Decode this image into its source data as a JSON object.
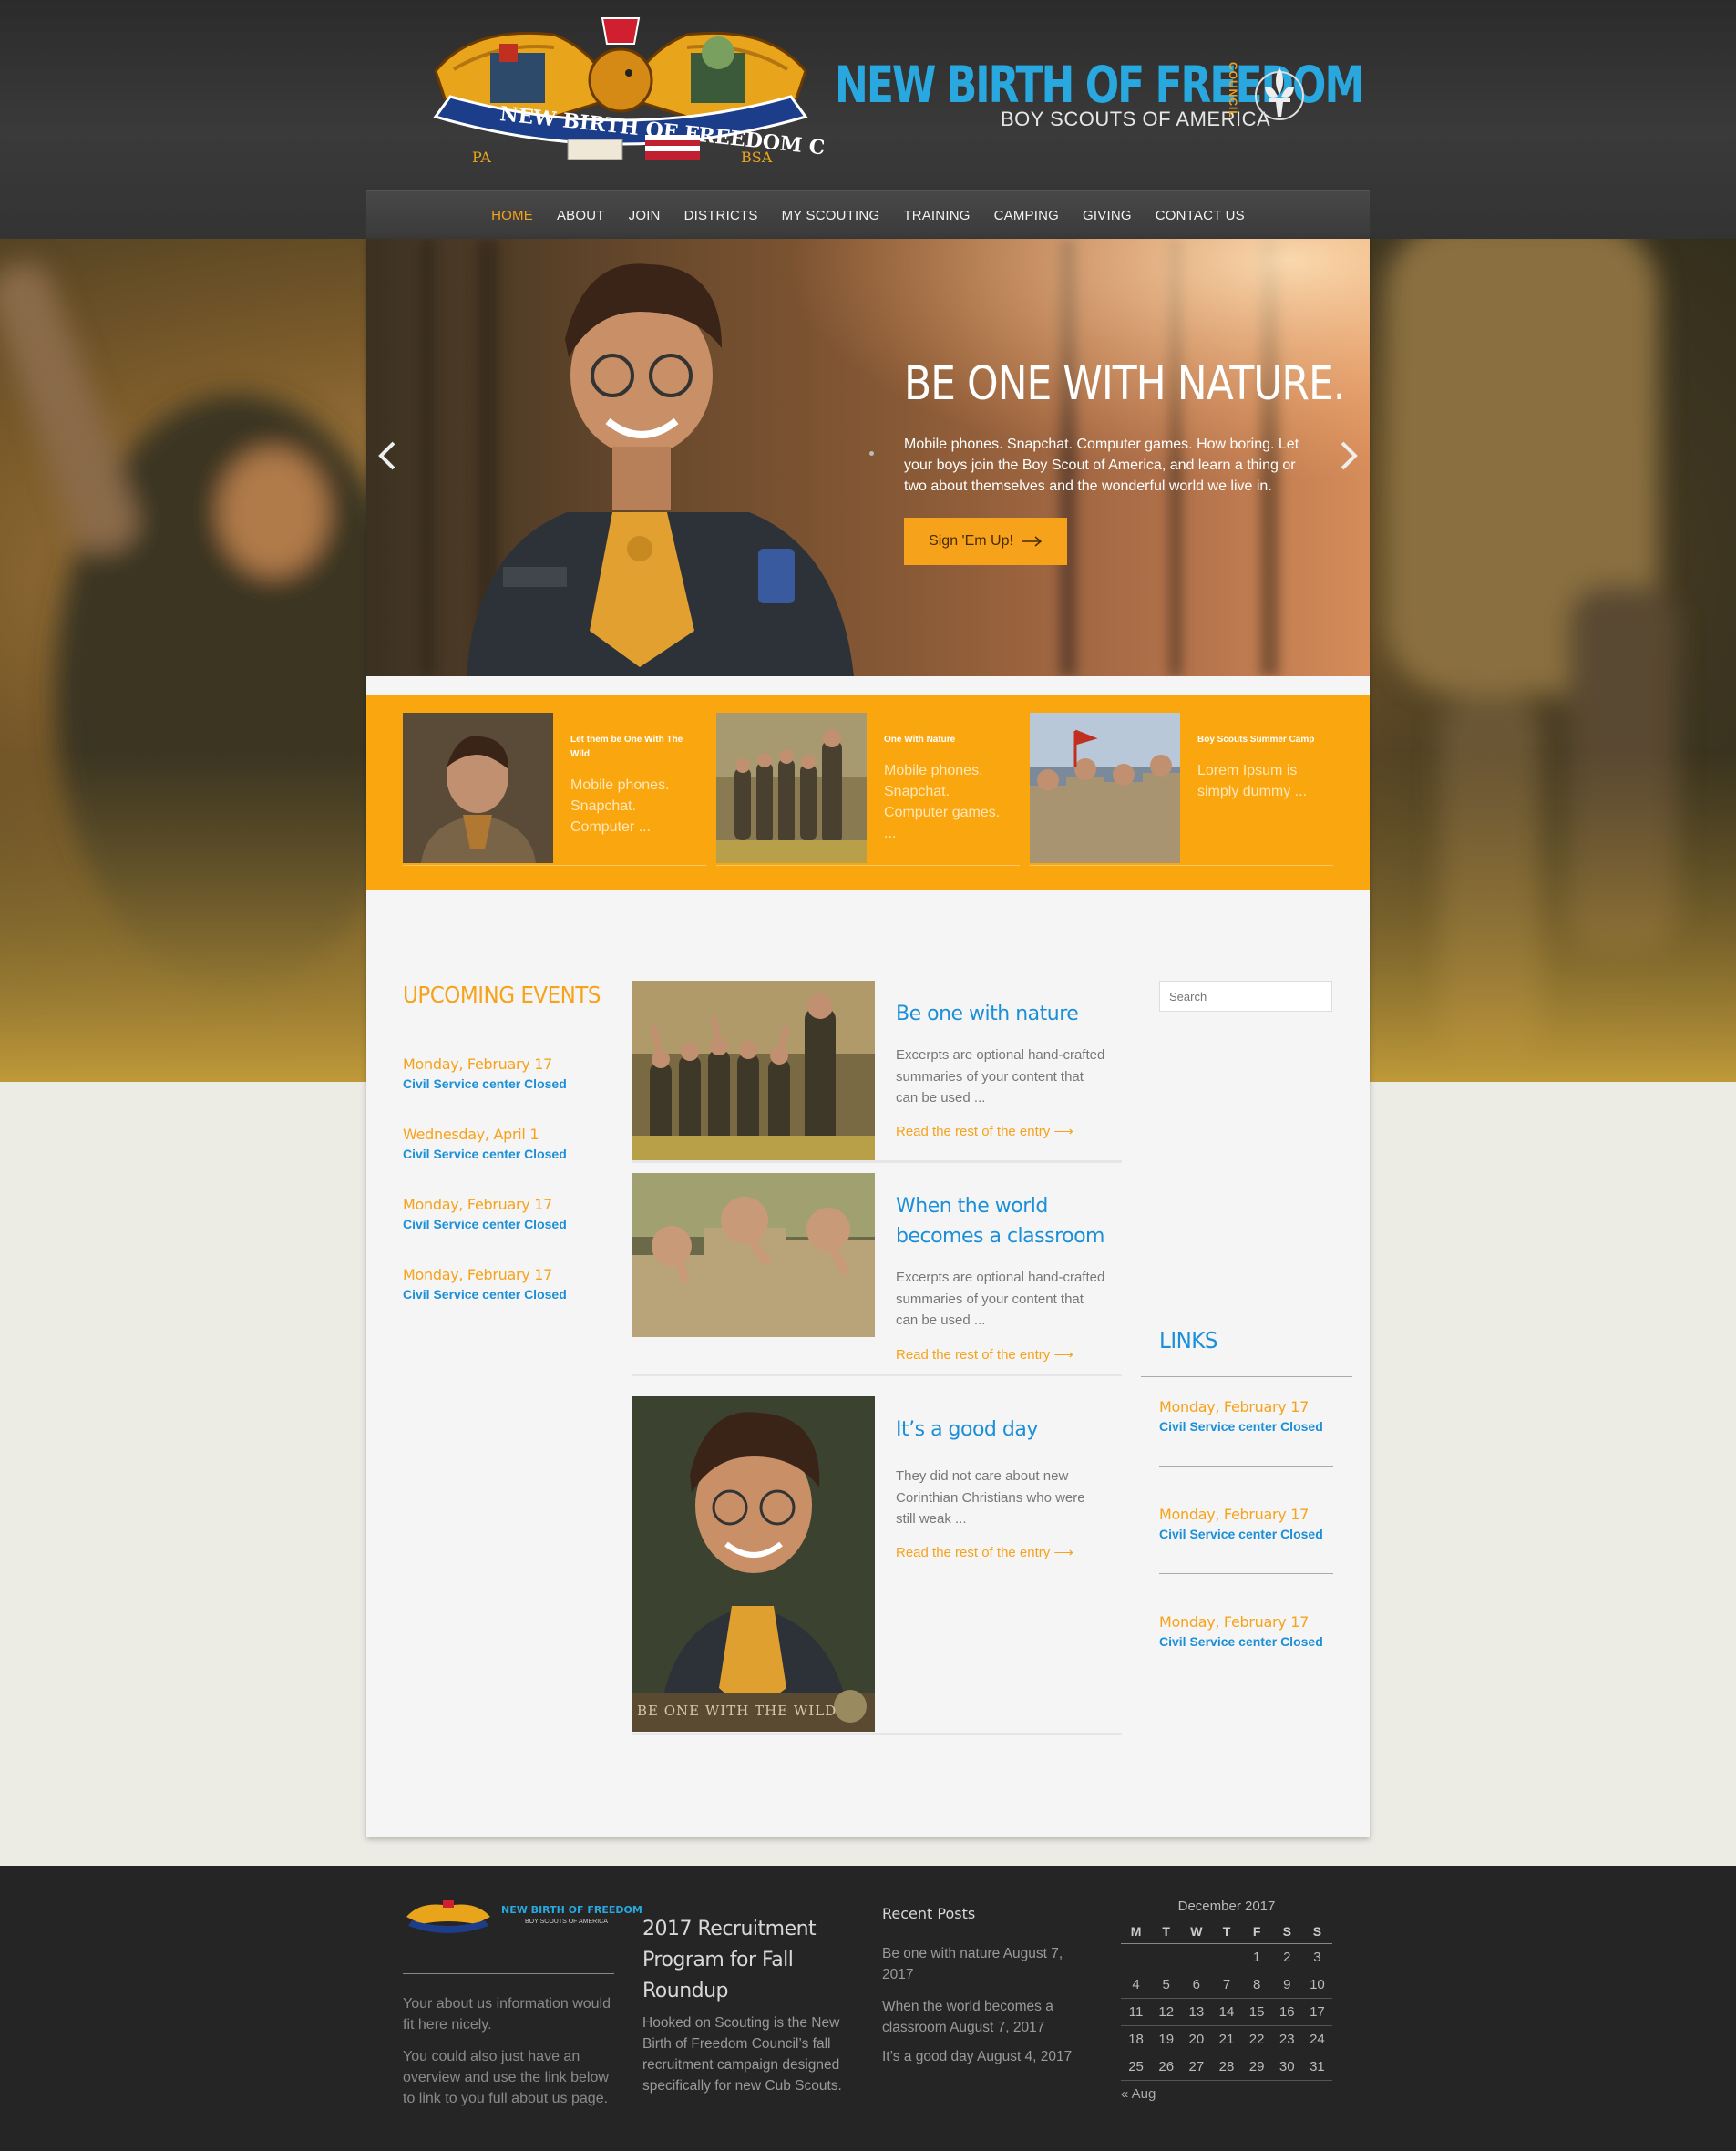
{
  "brand": {
    "wordmark_main": "NEW BIRTH OF FREEDOM",
    "wordmark_sub": "BOY SCOUTS OF AMERICA",
    "wordmark_council": "COUNCIL",
    "crest_ribbon": "NEW BIRTH OF FREEDOM COUNCIL",
    "crest_left": "PA",
    "crest_right": "BSA",
    "colors": {
      "blue": "#29a8e0",
      "orange": "#f7a21b"
    }
  },
  "nav": {
    "items": [
      "HOME",
      "ABOUT",
      "JOIN",
      "DISTRICTS",
      "MY SCOUTING",
      "TRAINING",
      "CAMPING",
      "GIVING",
      "CONTACT US"
    ],
    "active": "HOME"
  },
  "hero": {
    "title": "BE ONE WITH NATURE.",
    "text": "Mobile phones. Snapchat. Computer games. How boring. Let your boys join the Boy Scout of America, and learn a thing or two about themselves and the wonderful world we live in.",
    "button": "Sign 'Em Up!",
    "prev_icon": "chevron-left-icon",
    "next_icon": "chevron-right-icon"
  },
  "featured": [
    {
      "title": "Let them be One With The Wild",
      "excerpt": "Mobile phones. Snapchat. Computer ..."
    },
    {
      "title": "One With Nature",
      "excerpt": "Mobile phones. Snapchat. Computer games. ..."
    },
    {
      "title": "Boy Scouts Summer Camp",
      "excerpt": "Lorem Ipsum is simply dummy ..."
    }
  ],
  "events": {
    "title": "UPCOMING EVENTS",
    "items": [
      {
        "date": "Monday, February 17",
        "name": "Civil Service center Closed"
      },
      {
        "date": "Wednesday, April 1",
        "name": "Civil Service center Closed"
      },
      {
        "date": "Monday, February 17",
        "name": "Civil Service center Closed"
      },
      {
        "date": "Monday, February 17",
        "name": "Civil Service center Closed"
      }
    ]
  },
  "posts": [
    {
      "title": "Be one with nature",
      "excerpt": "Excerpts are optional hand-crafted summaries of your content that can be used ...",
      "more": "Read the rest of the entry ⟶"
    },
    {
      "title": "When the world becomes a classroom",
      "excerpt": "Excerpts are optional hand-crafted summaries of your content that can be used ...",
      "more": "Read the rest of the entry ⟶"
    },
    {
      "title": "It’s a good day",
      "excerpt": "They did not care about new Corinthian Christians who were still weak ...",
      "more": "Read the rest of the entry ⟶",
      "image_caption": "BE ONE WITH THE WILD"
    }
  ],
  "sidebar": {
    "search_placeholder": "Search",
    "links_title": "LINKS",
    "links": [
      {
        "date": "Monday, February 17",
        "name": "Civil Service center Closed"
      },
      {
        "date": "Monday, February 17",
        "name": "Civil Service center Closed"
      },
      {
        "date": "Monday, February 17",
        "name": "Civil Service center Closed"
      }
    ]
  },
  "footer": {
    "logo_text": "NEW BIRTH OF FREEDOM",
    "logo_sub": "BOY SCOUTS OF AMERICA",
    "about_1": "Your about us information would fit here nicely.",
    "about_2": "You could also just have an overview and use the link below to link to you full about us page.",
    "post_title": "2017 Recruitment Program for Fall Roundup",
    "post_text": "Hooked on Scouting is the New Birth of Freedom Council’s fall recruitment campaign designed specifically for new Cub Scouts.",
    "recent_title": "Recent Posts",
    "recent": [
      "Be one with nature August 7, 2017",
      "When the world becomes a classroom August 7, 2017",
      "It’s a good day August 4, 2017"
    ],
    "calendar": {
      "caption": "December 2017",
      "days": [
        "M",
        "T",
        "W",
        "T",
        "F",
        "S",
        "S"
      ],
      "weeks": [
        [
          "",
          "",
          "",
          "",
          "1",
          "2",
          "3"
        ],
        [
          "4",
          "5",
          "6",
          "7",
          "8",
          "9",
          "10"
        ],
        [
          "11",
          "12",
          "13",
          "14",
          "15",
          "16",
          "17"
        ],
        [
          "18",
          "19",
          "20",
          "21",
          "22",
          "23",
          "24"
        ],
        [
          "25",
          "26",
          "27",
          "28",
          "29",
          "30",
          "31"
        ]
      ],
      "prev": "« Aug"
    }
  }
}
